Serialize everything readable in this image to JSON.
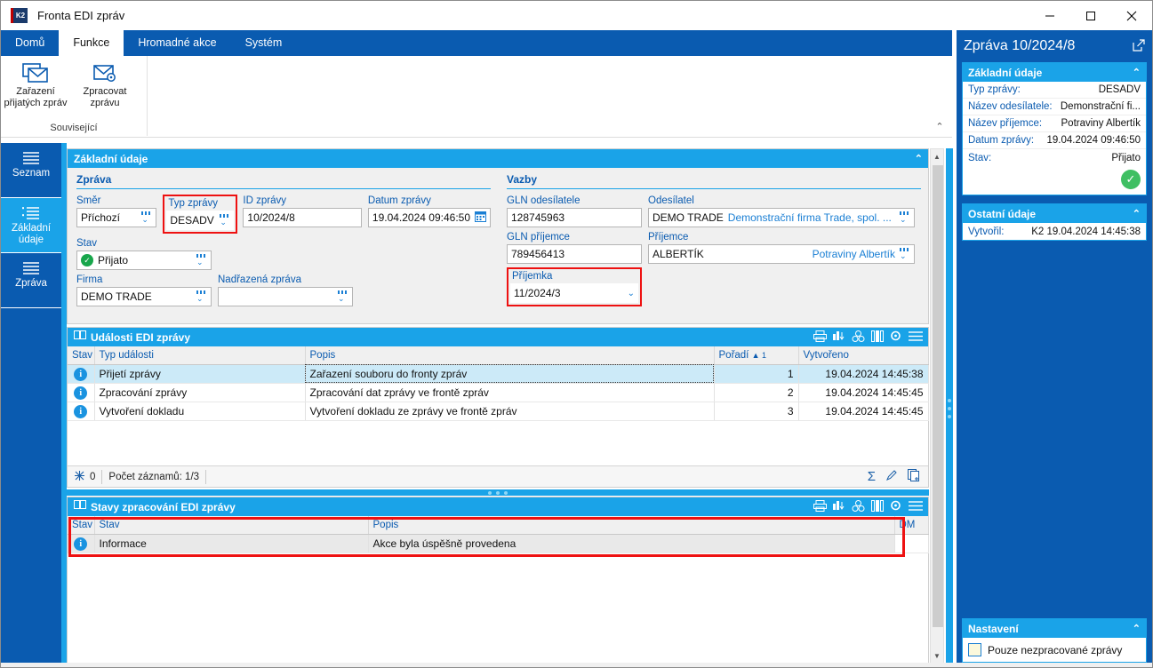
{
  "window": {
    "title": "Fronta EDI zpráv",
    "icon": "k2-logo-icon",
    "minimize": "–",
    "maximize": "□",
    "close": "✕"
  },
  "ribbon": {
    "tabs": [
      {
        "label": "Domů",
        "active": false
      },
      {
        "label": "Funkce",
        "active": true
      },
      {
        "label": "Hromadné akce",
        "active": false
      },
      {
        "label": "Systém",
        "active": false
      }
    ],
    "group_label": "Související",
    "buttons": [
      {
        "label_line1": "Zařazení",
        "label_line2": "přijatých zpráv",
        "icon": "envelope-icon"
      },
      {
        "label_line1": "Zpracovat",
        "label_line2": "zprávu",
        "icon": "envelope-gear-icon"
      }
    ]
  },
  "leftnav": [
    {
      "label": "Seznam",
      "icon": "list-icon",
      "active": false
    },
    {
      "label": "Základní údaje",
      "icon": "list-bullet-icon",
      "active": true
    },
    {
      "label": "Zpráva",
      "icon": "list-icon",
      "active": false
    }
  ],
  "basic_panel": {
    "title": "Základní údaje",
    "message_section": {
      "title": "Zpráva",
      "fields": {
        "smer_label": "Směr",
        "smer_value": "Příchozí",
        "typ_zpravy_label": "Typ zprávy",
        "typ_zpravy_value": "DESADV",
        "id_zpravy_label": "ID zprávy",
        "id_zpravy_value": "10/2024/8",
        "datum_zpravy_label": "Datum zprávy",
        "datum_zpravy_value": "19.04.2024 09:46:50",
        "stav_label": "Stav",
        "stav_value": "Přijato",
        "firma_label": "Firma",
        "firma_value": "DEMO TRADE",
        "nadrazena_label": "Nadřazená zpráva",
        "nadrazena_value": ""
      }
    },
    "links_section": {
      "title": "Vazby",
      "fields": {
        "gln_odesilatele_label": "GLN odesílatele",
        "gln_odesilatele_value": "128745963",
        "odesilatel_label": "Odesílatel",
        "odesilatel_value": "DEMO TRADE",
        "odesilatel_sub": "Demonstrační firma Trade, spol. ...",
        "gln_prijemce_label": "GLN příjemce",
        "gln_prijemce_value": "789456413",
        "prijemce_label": "Příjemce",
        "prijemce_value": "ALBERTÍK",
        "prijemce_sub": "Potraviny Albertík",
        "prijemka_label": "Příjemka",
        "prijemka_value": "11/2024/3"
      }
    }
  },
  "events_grid": {
    "title": "Události EDI zprávy",
    "toolbar_icons": [
      "print-icon",
      "chart-icon",
      "pivot-icon",
      "columns-icon",
      "gear-icon",
      "menu-icon"
    ],
    "columns": [
      "Stav",
      "Typ události",
      "Popis",
      "Pořadí",
      "Vytvořeno"
    ],
    "sort_column": "Pořadí",
    "sort_indicator": "▲ 1",
    "rows": [
      {
        "stav": "info-icon",
        "typ": "Přijetí zprávy",
        "popis": "Zařazení souboru do fronty zpráv",
        "poradi": "1",
        "vytvoreno": "19.04.2024 14:45:38",
        "selected": true
      },
      {
        "stav": "info-icon",
        "typ": "Zpracování zprávy",
        "popis": "Zpracování dat zprávy ve frontě zpráv",
        "poradi": "2",
        "vytvoreno": "19.04.2024 14:45:45",
        "selected": false
      },
      {
        "stav": "info-icon",
        "typ": "Vytvoření dokladu",
        "popis": "Vytvoření dokladu ze zprávy ve frontě zpráv",
        "poradi": "3",
        "vytvoreno": "19.04.2024 14:45:45",
        "selected": false
      }
    ],
    "footer": {
      "flag_count": "0",
      "record_count": "Počet záznamů: 1/3",
      "right_icons": [
        "sum-icon",
        "edit-icon",
        "copy-icon"
      ]
    }
  },
  "states_grid": {
    "title": "Stavy zpracování EDI zprávy",
    "toolbar_icons": [
      "print-icon",
      "chart-icon",
      "pivot-icon",
      "columns-icon",
      "gear-icon",
      "menu-icon"
    ],
    "columns": [
      "Stav",
      "Stav",
      "Popis",
      "DM"
    ],
    "rows": [
      {
        "stav_icon": "info-icon",
        "stav": "Informace",
        "popis": "Akce byla úspěšně provedena",
        "dm": ""
      }
    ]
  },
  "right_panel": {
    "title": "Zpráva 10/2024/8",
    "open_icon": "external-link-icon",
    "cards": [
      {
        "title": "Základní údaje",
        "collapse_icon": "chevron-up-icon",
        "rows": [
          {
            "key": "Typ zprávy:",
            "value": "DESADV"
          },
          {
            "key": "Název odesílatele:",
            "value": "Demonstrační fi..."
          },
          {
            "key": "Název příjemce:",
            "value": "Potraviny Albertík"
          },
          {
            "key": "Datum zprávy:",
            "value": "19.04.2024 09:46:50"
          },
          {
            "key": "Stav:",
            "value": "Přijato"
          }
        ],
        "status_icon": "check-circle-icon"
      },
      {
        "title": "Ostatní údaje",
        "collapse_icon": "chevron-up-icon",
        "rows": [
          {
            "key": "Vytvořil:",
            "value": "K2 19.04.2024 14:45:38"
          }
        ]
      }
    ],
    "settings": {
      "title": "Nastavení",
      "collapse_icon": "chevron-up-icon",
      "checkbox_label": "Pouze nezpracované zprávy",
      "checkbox_checked": false
    }
  },
  "colors": {
    "brand_blue": "#0a5bb0",
    "accent_cyan": "#1aa3e8",
    "highlight_red": "#ee1111",
    "status_green": "#3fbf63"
  }
}
